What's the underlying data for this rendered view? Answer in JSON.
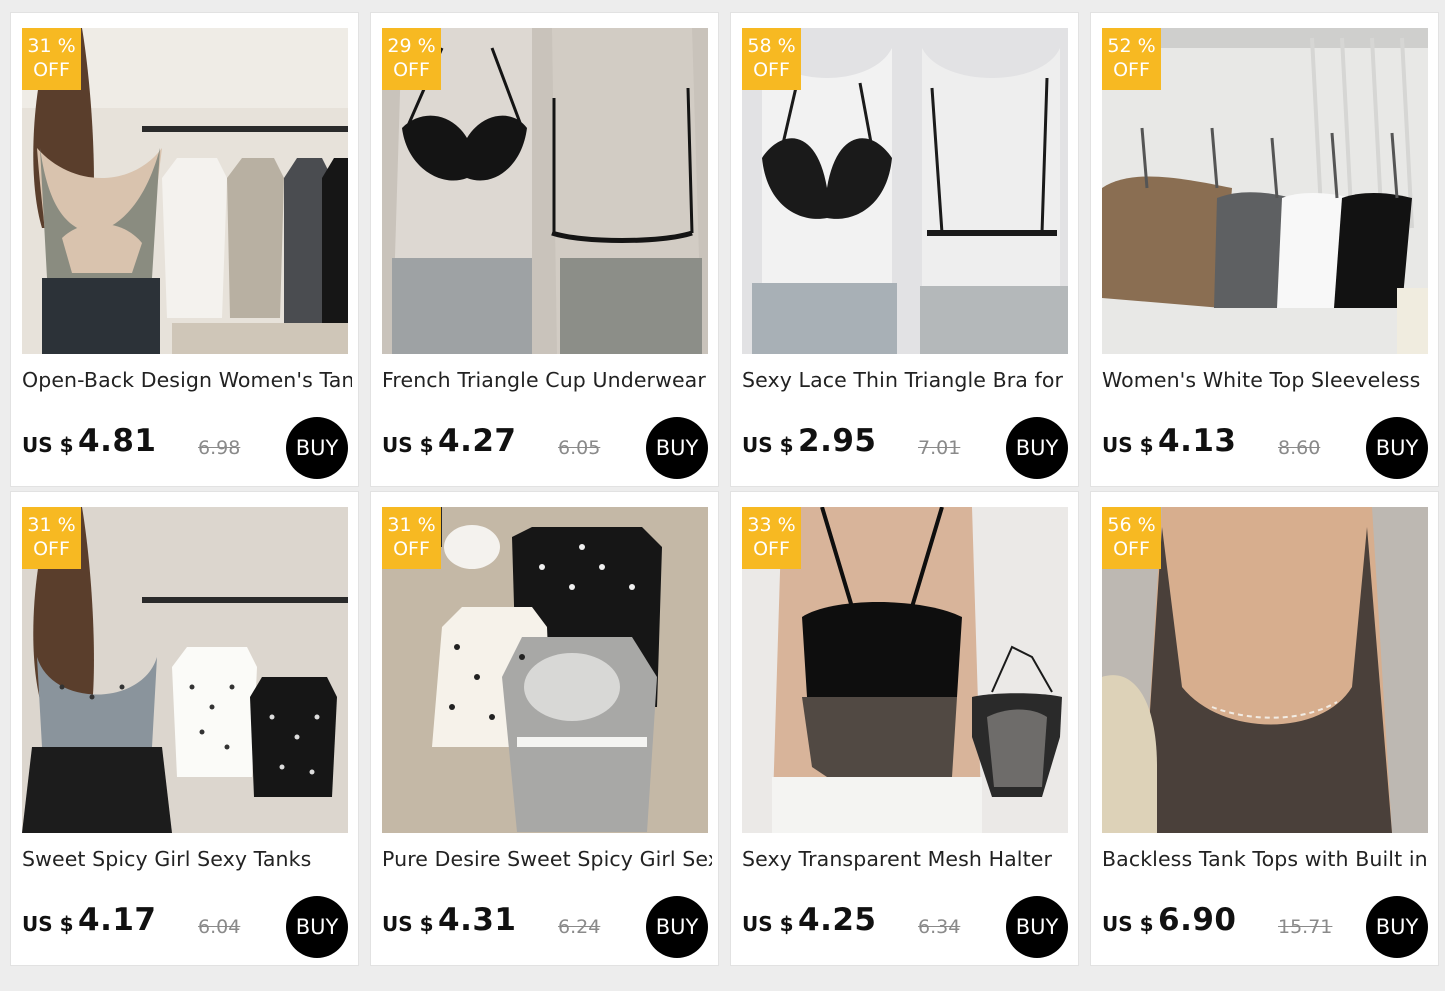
{
  "currency_label": "US $",
  "buy_label": "BUY",
  "products": [
    {
      "discount": "31 %",
      "off": "OFF",
      "title": "Open-Back Design Women's Tank",
      "price": "4.81",
      "old_price": "6.98",
      "image_icon": "gray-tank-top-product-photo",
      "colors": {
        "bg": "#d8d2c8",
        "main": "#8a8c82"
      }
    },
    {
      "discount": "29 %",
      "off": "OFF",
      "title": "French Triangle Cup Underwear",
      "price": "4.27",
      "old_price": "6.05",
      "image_icon": "black-bra-mannequin-photo",
      "colors": {
        "bg": "#c8c2bc",
        "main": "#141414"
      }
    },
    {
      "discount": "58 %",
      "off": "OFF",
      "title": "Sexy Lace Thin Triangle Bra for",
      "price": "2.95",
      "old_price": "7.01",
      "image_icon": "lace-bra-mannequin-photo",
      "colors": {
        "bg": "#e6e6e8",
        "main": "#1a1a1a"
      }
    },
    {
      "discount": "52 %",
      "off": "OFF",
      "title": "Women's White Top Sleeveless",
      "price": "4.13",
      "old_price": "8.60",
      "image_icon": "tube-tops-row-photo",
      "colors": {
        "bg": "#e4e4e2",
        "main": "#8a6e52"
      }
    },
    {
      "discount": "31 %",
      "off": "OFF",
      "title": "Sweet Spicy Girl Sexy Tanks",
      "price": "4.17",
      "old_price": "6.04",
      "image_icon": "polka-dot-cami-photo",
      "colors": {
        "bg": "#d6d0c8",
        "main": "#8a949c"
      }
    },
    {
      "discount": "31 %",
      "off": "OFF",
      "title": "Pure Desire Sweet Spicy Girl Sexy",
      "price": "4.31",
      "old_price": "6.24",
      "image_icon": "polka-dot-cami-flatlay-photo",
      "colors": {
        "bg": "#c2b6a4",
        "main": "#1c1c1c"
      }
    },
    {
      "discount": "33 %",
      "off": "OFF",
      "title": "Sexy Transparent Mesh Halter",
      "price": "4.25",
      "old_price": "6.34",
      "image_icon": "mesh-halter-top-photo",
      "colors": {
        "bg": "#e8e6e4",
        "main": "#0e0e0e"
      }
    },
    {
      "discount": "56 %",
      "off": "OFF",
      "title": "Backless Tank Tops with Built in",
      "price": "6.90",
      "old_price": "15.71",
      "image_icon": "backless-brown-tank-photo",
      "colors": {
        "bg": "#cfcac4",
        "main": "#4a403a"
      }
    }
  ]
}
